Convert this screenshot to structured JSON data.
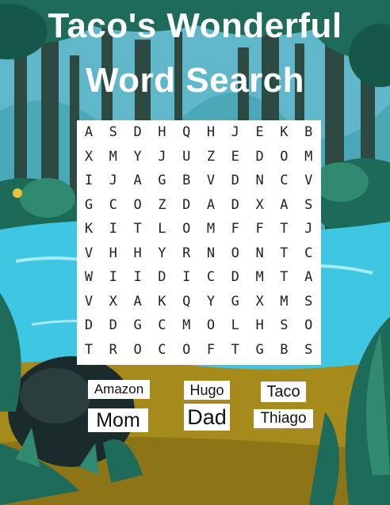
{
  "title": {
    "line1": "Taco's Wonderful",
    "line2": "Word Search"
  },
  "grid": [
    [
      "A",
      "S",
      "D",
      "H",
      "Q",
      "H",
      "J",
      "E",
      "K",
      "B"
    ],
    [
      "X",
      "M",
      "Y",
      "J",
      "U",
      "Z",
      "E",
      "D",
      "O",
      "M"
    ],
    [
      "I",
      "J",
      "A",
      "G",
      "B",
      "V",
      "D",
      "N",
      "C",
      "V"
    ],
    [
      "G",
      "C",
      "O",
      "Z",
      "D",
      "A",
      "D",
      "X",
      "A",
      "S"
    ],
    [
      "K",
      "I",
      "T",
      "L",
      "O",
      "M",
      "F",
      "F",
      "T",
      "J"
    ],
    [
      "V",
      "H",
      "H",
      "Y",
      "R",
      "N",
      "O",
      "N",
      "T",
      "C"
    ],
    [
      "W",
      "I",
      "I",
      "D",
      "I",
      "C",
      "D",
      "M",
      "T",
      "A"
    ],
    [
      "V",
      "X",
      "A",
      "K",
      "Q",
      "Y",
      "G",
      "X",
      "M",
      "S"
    ],
    [
      "D",
      "D",
      "G",
      "C",
      "M",
      "O",
      "L",
      "H",
      "S",
      "O"
    ],
    [
      "T",
      "R",
      "O",
      "C",
      "O",
      "F",
      "T",
      "G",
      "B",
      "S"
    ]
  ],
  "words": [
    "Amazon",
    "Hugo",
    "Taco",
    "Mom",
    "Dad",
    "Thiago"
  ],
  "colors": {
    "sky": "#8fd3e6",
    "water": "#3fc6e3",
    "ground": "#a78a1c",
    "foliage": "#1f6b5a",
    "trunk": "#2d4a42",
    "title": "#ffffff"
  }
}
